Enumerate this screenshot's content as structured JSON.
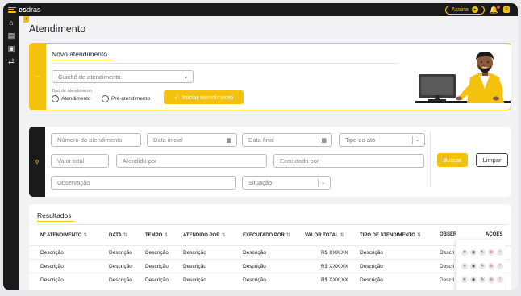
{
  "app": {
    "brand_bold": "es",
    "brand_light": "dras"
  },
  "topbar": {
    "assina_label": "Assina"
  },
  "page": {
    "title": "Atendimento"
  },
  "novo": {
    "title": "Novo atendimento",
    "guiche_placeholder": "Guichê de atendimento",
    "tipo_label": "Tipo de atendimento",
    "radio_atendimento": "Atendimento",
    "radio_pre": "Pré-atendimento",
    "iniciar_label": "Iniciar atendimento"
  },
  "filtro": {
    "numero": "Número do atendimento",
    "data_inicial": "Data inicial",
    "data_final": "Data final",
    "tipo_ato": "Tipo do ato",
    "valor_total": "Valor total",
    "atendido_por": "Atendido por",
    "executado_por": "Executado por",
    "observacao": "Observação",
    "situacao": "Situação",
    "buscar": "Buscar",
    "limpar": "Limpar"
  },
  "resultados": {
    "title": "Resultados",
    "columns": [
      "Nº ATENDIMENTO",
      "DATA",
      "TEMPO",
      "ATENDIDO POR",
      "EXECUTADO POR",
      "VALOR TOTAL",
      "TIPO DE ATENDIMENTO",
      "OBSER",
      "AÇÕES"
    ],
    "rows": [
      [
        "Descrição",
        "Descrição",
        "Descrição",
        "Descrição",
        "Descrição",
        "R$ XXX,XX",
        "Descrição",
        "Descri"
      ],
      [
        "Descrição",
        "Descrição",
        "Descrição",
        "Descrição",
        "Descrição",
        "R$ XXX,XX",
        "Descrição",
        "Descri"
      ],
      [
        "Descrição",
        "Descrição",
        "Descrição",
        "Descrição",
        "Descrição",
        "R$ XXX,XX",
        "Descrição",
        "Descri"
      ]
    ]
  },
  "colors": {
    "accent": "#f4c20d",
    "dark": "#1a1a1a"
  }
}
